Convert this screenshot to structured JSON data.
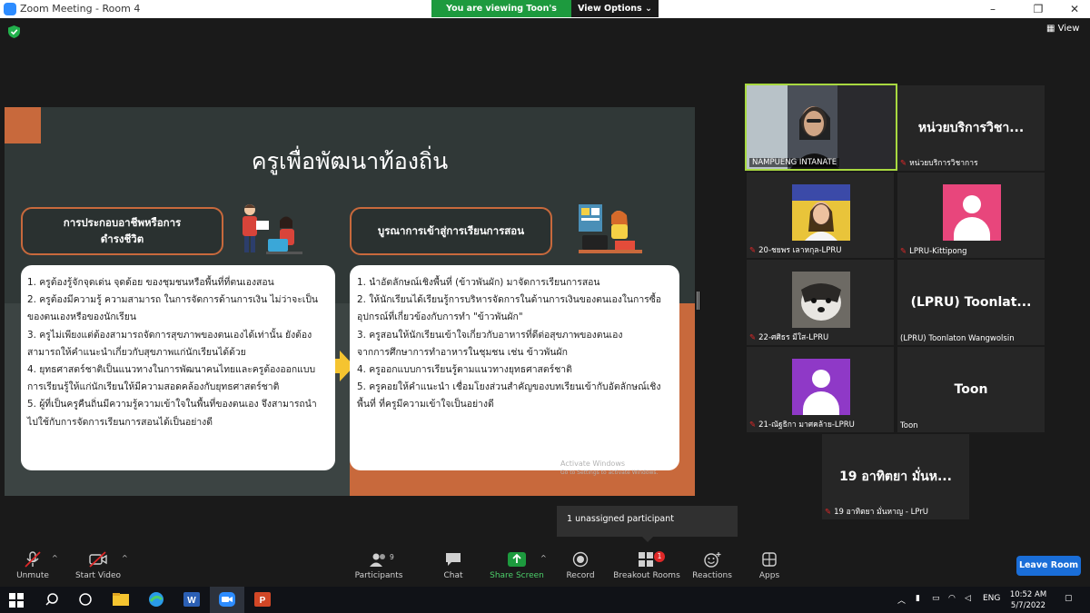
{
  "window": {
    "title": "Zoom Meeting - Room 4",
    "viewing_banner": "You are viewing Toon's screen",
    "view_options": "View Options",
    "minimize": "–",
    "maximize": "❐",
    "close": "✕"
  },
  "top_right": {
    "view_label": "View"
  },
  "slide": {
    "heading": "ครูเพื่อพัฒนาท้องถิ่น",
    "pill_left": "การประกอบอาชีพหรือการ\nดำรงชีวิต",
    "pill_right": "บูรณาการเข้าสู่การเรียนการสอน",
    "left_items": [
      "1. ครูต้องรู้จักจุดเด่น จุดด้อย ของชุมชนหรือพื้นที่ที่ตนเองสอน",
      "2. ครูต้องมีความรู้ ความสามารถ ในการจัดการด้านการเงิน ไม่ว่าจะเป็น",
      "ของตนเองหรือของนักเรียน",
      "3. ครูไม่เพียงแต่ต้องสามารถจัดการสุขภาพของตนเองได้เท่านั้น ยังต้อง",
      "สามารถให้คำแนะนำเกี่ยวกับสุขภาพแก่นักเรียนได้ด้วย",
      "4. ยุทธศาสตร์ชาติเป็นแนวทางในการพัฒนาคนไทยและครูต้องออกแบบ",
      "การเรียนรู้ให้แก่นักเรียนให้มีความสอดคล้องกับยุทธศาสตร์ชาติ",
      "5.  ผู้ที่เป็นครูคืนถิ่นมีความรู้ความเข้าใจในพื้นที่ของตนเอง จึงสามารถนำ",
      "ไปใช้กับการจัดการเรียนการสอนได้เป็นอย่างดี"
    ],
    "right_items": [
      "1. นำอัตลักษณ์เชิงพื้นที่ (ข้าวพันผัก) มาจัดการเรียนการสอน",
      "2. ให้นักเรียนได้เรียนรู้การบริหารจัดการในด้านการเงินของตนเองในการซื้อ",
      "อุปกรณ์ที่เกี่ยวข้องกับการทำ \"ข้าวพันผัก\"",
      "3. ครูสอนให้นักเรียนเข้าใจเกี่ยวกับอาหารที่ดีต่อสุขภาพของตนเอง",
      "จากการศึกษาการทำอาหารในชุมชน เช่น ข้าวพันผัก",
      "4. ครูออกแบบการเรียนรู้ตามแนวทางยุทธศาสตร์ชาติ",
      "5.  ครูคอยให้คำแนะนำ เชื่อมโยงส่วนสำคัญของบทเรียนเข้ากับอัตลักษณ์เชิง",
      "พื้นที่ ที่ครูมีความเข้าใจเป็นอย่างดี"
    ],
    "watermark_title": "Activate Windows",
    "watermark_sub": "Go to Settings to activate Windows."
  },
  "gallery": [
    {
      "id": "t1",
      "name_big": "",
      "label": "NAMPUENG INTANATE",
      "muted": false
    },
    {
      "id": "t2",
      "name_big": "หน่วยบริการวิชา...",
      "label": "หน่วยบริการวิชาการ",
      "muted": true
    },
    {
      "id": "t3",
      "name_big": "",
      "label": "20-ชยพร เลาหกุล-LPRU",
      "muted": true
    },
    {
      "id": "t4",
      "name_big": "",
      "label": "LPRU-Kittipong",
      "muted": true
    },
    {
      "id": "t5",
      "name_big": "",
      "label": "22-ศศิธร มีใส-LPRU",
      "muted": true
    },
    {
      "id": "t6",
      "name_big": "(LPRU)  Toonlat...",
      "label": "(LPRU) Toonlaton Wangwolsin",
      "muted": false
    },
    {
      "id": "t7",
      "name_big": "",
      "label": "21-ณัฐธิกา มาศคล้าย-LPRU",
      "muted": true
    },
    {
      "id": "t8",
      "name_big": "Toon",
      "label": "Toon",
      "muted": false
    },
    {
      "id": "t9",
      "name_big": "19 อาทิตยา มั่นห...",
      "label": "19 อาทิตยา มั่นหาญ - LPrU",
      "muted": true
    }
  ],
  "popup": {
    "unassigned": "1 unassigned participant"
  },
  "toolbar": {
    "unmute": "Unmute",
    "start_video": "Start Video",
    "participants": "Participants",
    "participants_count": "9",
    "chat": "Chat",
    "share_screen": "Share Screen",
    "record": "Record",
    "breakout_rooms": "Breakout Rooms",
    "breakout_badge": "1",
    "reactions": "Reactions",
    "apps": "Apps",
    "leave_room": "Leave Room",
    "chevron": "^"
  },
  "taskbar": {
    "lang": "ENG",
    "time": "10:52 AM",
    "date": "5/7/2022"
  },
  "colors": {
    "accent_orange": "#c8693c",
    "slide_bg": "#303837",
    "zoom_blue": "#1a6ed8",
    "active_speaker": "#a8d940",
    "share_green": "#1d9a3e"
  }
}
